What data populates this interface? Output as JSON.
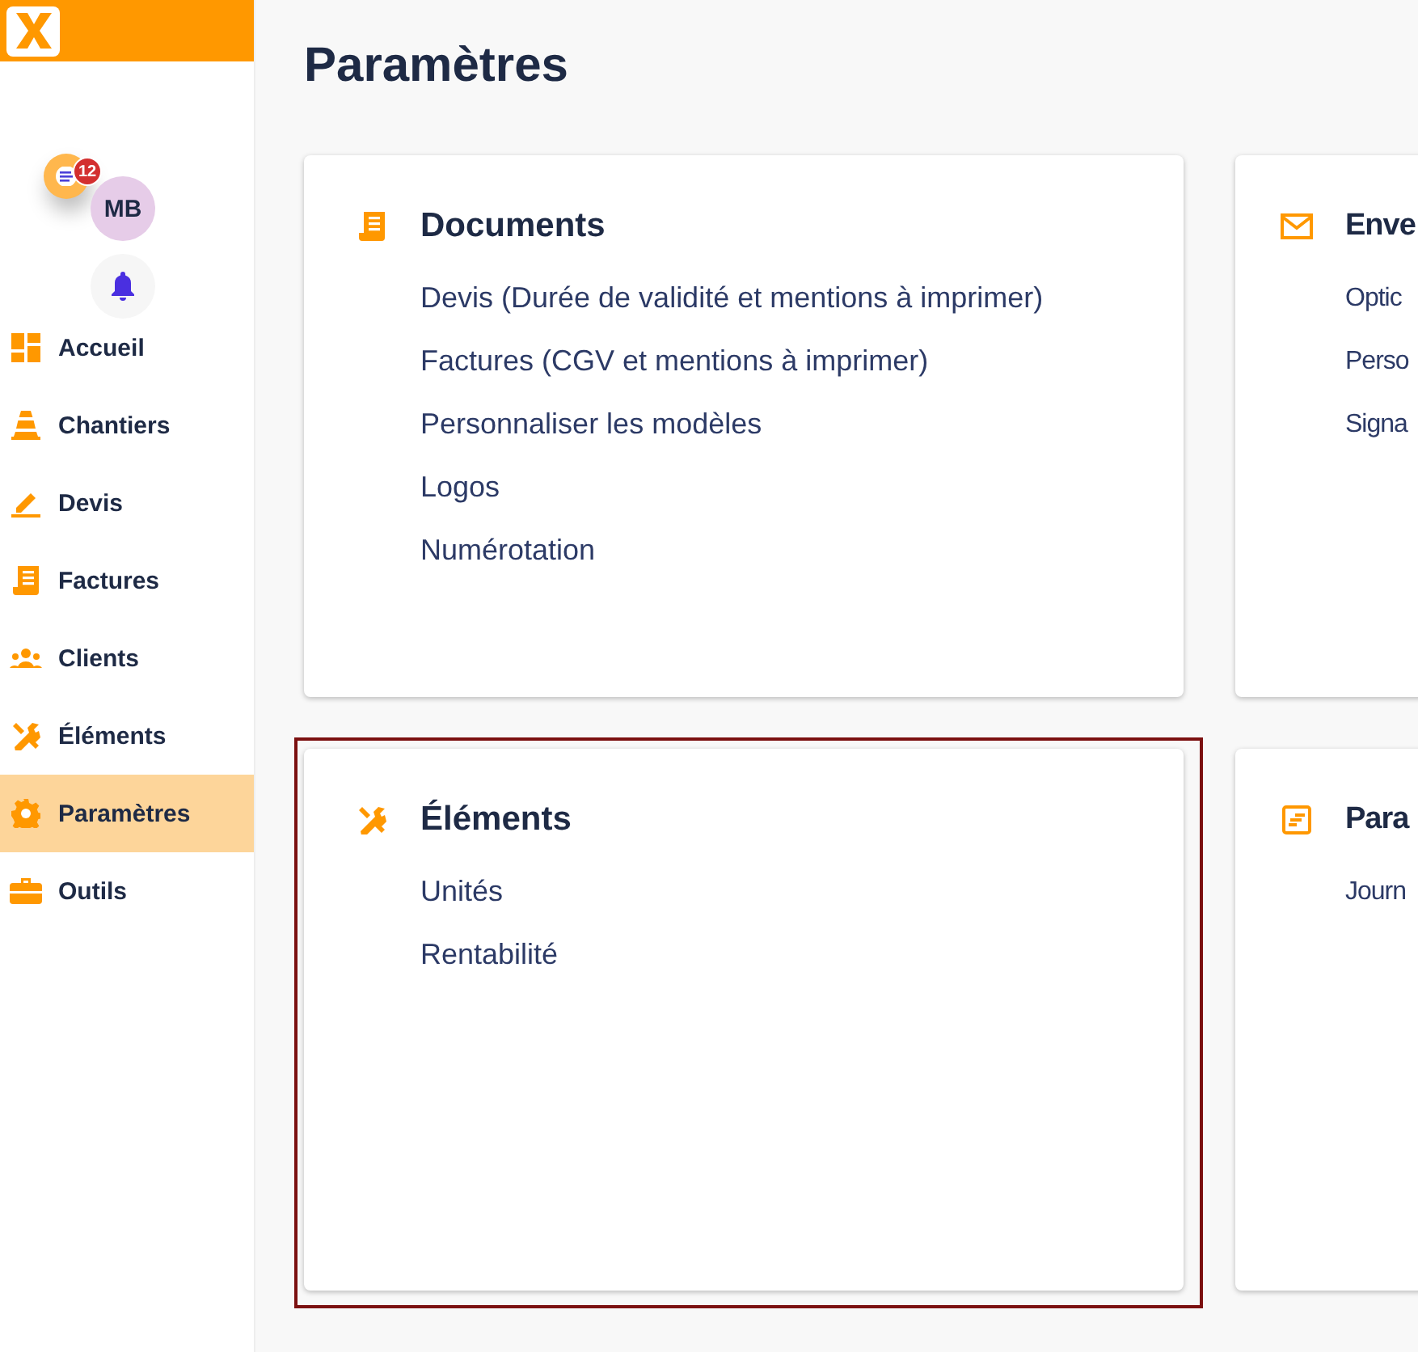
{
  "sidebar": {
    "notification_badge": "12",
    "avatar": "MB",
    "items": [
      {
        "label": "Accueil",
        "selected": false
      },
      {
        "label": "Chantiers",
        "selected": false
      },
      {
        "label": "Devis",
        "selected": false
      },
      {
        "label": "Factures",
        "selected": false
      },
      {
        "label": "Clients",
        "selected": false
      },
      {
        "label": "Éléments",
        "selected": false
      },
      {
        "label": "Paramètres",
        "selected": true
      },
      {
        "label": "Outils",
        "selected": false
      }
    ]
  },
  "page_title": "Paramètres",
  "cards": [
    {
      "title": "Documents",
      "highlighted": false,
      "links": [
        "Devis (Durée de validité et mentions à imprimer)",
        "Factures (CGV et mentions à imprimer)",
        "Personnaliser les modèles",
        "Logos",
        "Numérotation"
      ]
    },
    {
      "title": "Enve",
      "highlighted": false,
      "links": [
        "Optic",
        "Perso",
        "Signa"
      ]
    },
    {
      "title": "Éléments",
      "highlighted": true,
      "links": [
        "Unités",
        "Rentabilité"
      ]
    },
    {
      "title": "Para",
      "highlighted": false,
      "links": [
        "Journ"
      ]
    }
  ]
}
